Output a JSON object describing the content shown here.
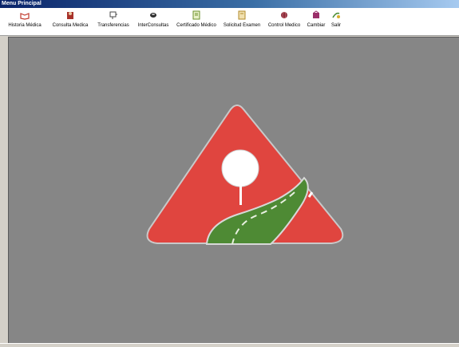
{
  "window": {
    "title": "Menu Principal"
  },
  "toolbar": {
    "items": [
      {
        "label": "Historia Médica",
        "icon": "book-icon",
        "color": "#c0392b"
      },
      {
        "label": "Consulta Medica",
        "icon": "doctor-icon",
        "color": "#a8322a"
      },
      {
        "label": "Transferencias",
        "icon": "monitor-icon",
        "color": "#4a4a4a"
      },
      {
        "label": "InterConsultas",
        "icon": "phone-icon",
        "color": "#2f2f2f"
      },
      {
        "label": "Certificado Médico",
        "icon": "certificate-icon",
        "color": "#6a8f2a"
      },
      {
        "label": "Solicitud Examen",
        "icon": "document-icon",
        "color": "#b08a2a"
      },
      {
        "label": "Control Medico",
        "icon": "globe-icon",
        "color": "#8b2b3b"
      },
      {
        "label": "Cambiar",
        "icon": "switch-icon",
        "color": "#9b2f6a"
      },
      {
        "label": "Salir",
        "icon": "exit-icon",
        "color": "#4c8f3a"
      }
    ]
  },
  "logo": {
    "name": "triangle-road-logo",
    "colors": {
      "red": "#e0453f",
      "green": "#4e8a34",
      "white": "#ffffff",
      "background": "#868686"
    }
  }
}
